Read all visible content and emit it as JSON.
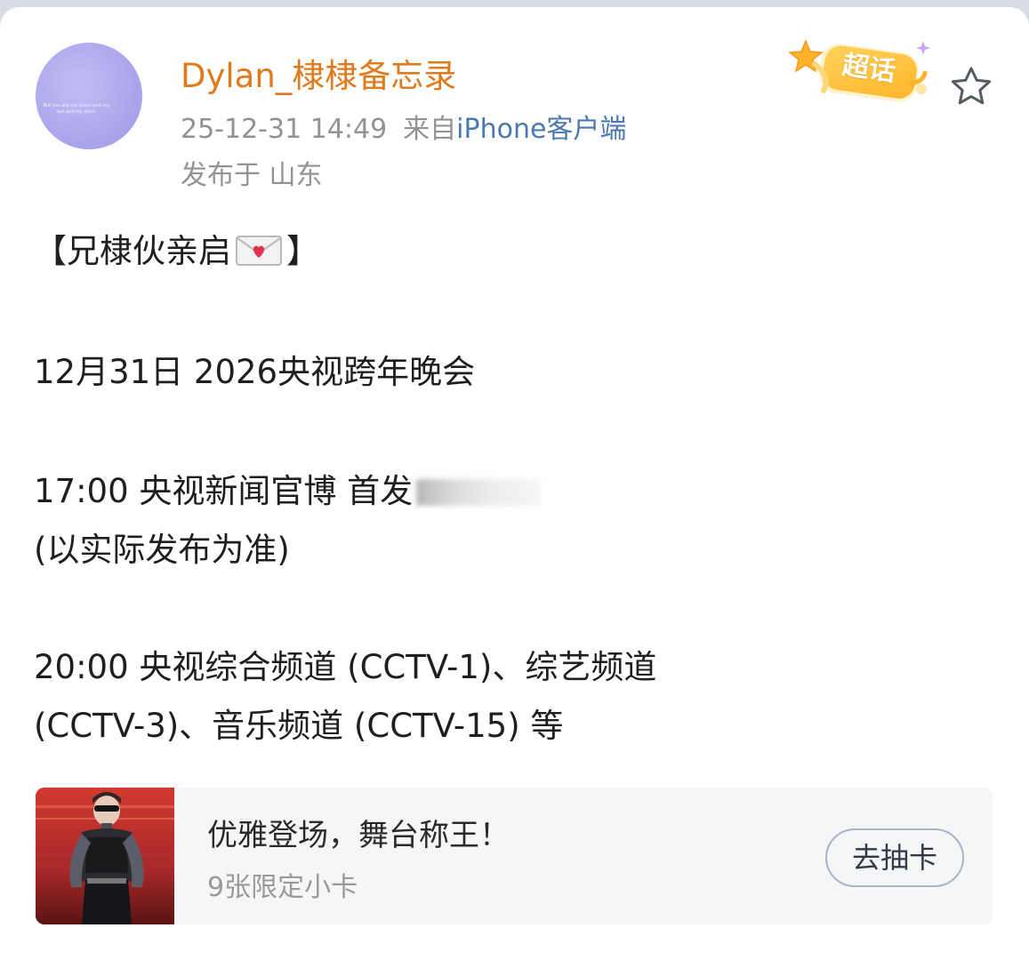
{
  "author": {
    "name": "Dylan_棣棣备忘录",
    "avatar_text": "But you are my moon and my sun and my stars."
  },
  "post_meta": {
    "timestamp": "25-12-31 14:49",
    "source_prefix": "来自",
    "device": "iPhone客户端",
    "location": "发布于 山东"
  },
  "badges": {
    "chaohua": "超话",
    "favorite_icon": "star-outline-icon"
  },
  "content": {
    "line1_open": "【兄棣伙亲启",
    "line1_close": "】",
    "line1_emoji": "love-letter-icon",
    "line2": "12月31日 2026央视跨年晚会",
    "line3": "17:00 央视新闻官博 首发",
    "line4": "(以实际发布为准)",
    "line5": "20:00 央视综合频道 (CCTV-1)、综艺频道",
    "line6": "(CCTV-3)、音乐频道 (CCTV-15) 等"
  },
  "promo_card": {
    "title": "优雅登场，舞台称王！",
    "subtitle": "9张限定小卡",
    "button_label": "去抽卡"
  },
  "colors": {
    "username": "#e07a1c",
    "meta_gray": "#939393",
    "device_link": "#4a79b0",
    "body_text": "#1f1f1f",
    "promo_bg": "#f5f6f8",
    "button_border": "#a9b4c4"
  }
}
